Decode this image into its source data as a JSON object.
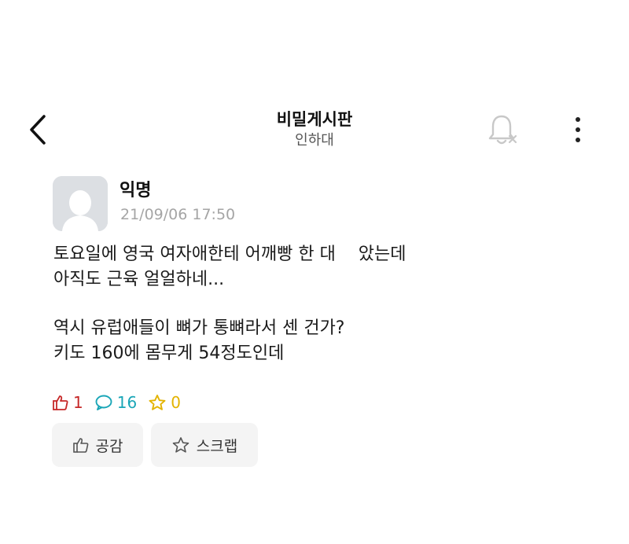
{
  "header": {
    "title": "비밀게시판",
    "subtitle": "인하대"
  },
  "icons": {
    "back": "chevron-left-icon",
    "notification": "bell-off-icon",
    "more": "more-vertical-icon",
    "like": "thumbs-up-icon",
    "comment": "comment-icon",
    "scrap": "star-icon"
  },
  "post": {
    "author": "익명",
    "datetime": "21/09/06 17:50",
    "body_lines": [
      "토요일에 영국 여자애한테 어깨빵 한 대　 았는데",
      "아직도 근육 얼얼하네...",
      "역시 유럽애들이 뼈가 통뼈라서 센 건가?",
      "키도 160에 몸무게 54정도인데"
    ],
    "stats": {
      "likes": "1",
      "comments": "16",
      "scraps": "0"
    }
  },
  "actions": {
    "like_label": "공감",
    "scrap_label": "스크랩"
  },
  "colors": {
    "like": "#c62828",
    "comment": "#1aa6b7",
    "scrap": "#e3b300",
    "datetime": "#a5a5a5",
    "button_bg": "#f4f4f4"
  }
}
